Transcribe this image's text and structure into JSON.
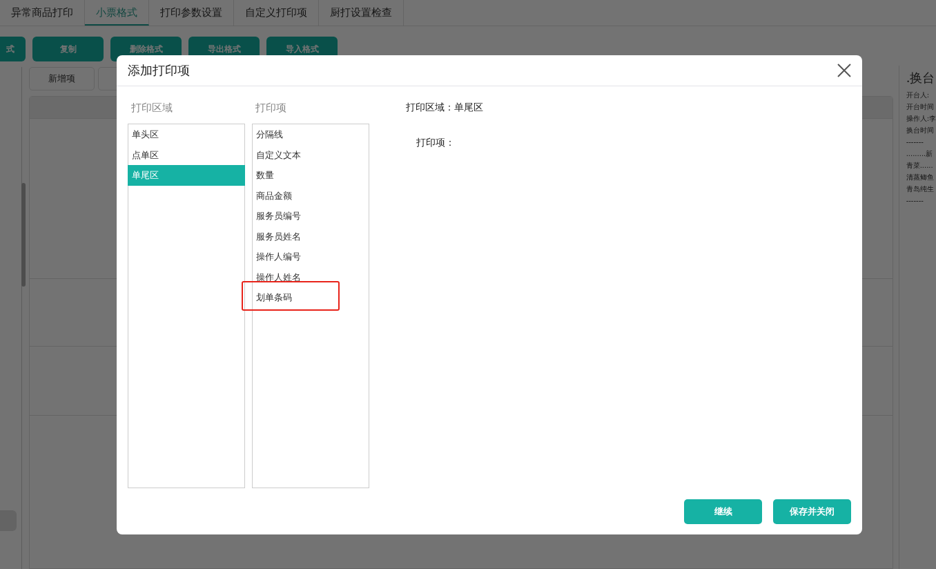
{
  "tabs": [
    {
      "label": "异常商品打印",
      "selected": false
    },
    {
      "label": "小票格式",
      "selected": true
    },
    {
      "label": "打印参数设置",
      "selected": false
    },
    {
      "label": "自定义打印项",
      "selected": false
    },
    {
      "label": "厨打设置检查",
      "selected": false
    }
  ],
  "toolbar_buttons": [
    "式",
    "复制",
    "删除格式",
    "导出格式",
    "导入格式"
  ],
  "sub_buttons": [
    "新增项"
  ],
  "receipt_preview": {
    "title": ".换台",
    "lines": [
      "开台人:",
      "开台时间",
      "操作人:李",
      "换台时间",
      "-------",
      ".........新",
      "青菜......",
      "清蒸鲫鱼",
      "青岛纯生",
      "-------"
    ]
  },
  "dialog": {
    "title": "添加打印项",
    "area_list": {
      "label": "打印区域",
      "items": [
        {
          "label": "单头区",
          "selected": false
        },
        {
          "label": "点单区",
          "selected": false
        },
        {
          "label": "单尾区",
          "selected": true
        }
      ]
    },
    "item_list": {
      "label": "打印项",
      "items": [
        {
          "label": "分隔线",
          "highlighted": false
        },
        {
          "label": "自定义文本",
          "highlighted": false
        },
        {
          "label": "数量",
          "highlighted": false
        },
        {
          "label": "商品金额",
          "highlighted": false
        },
        {
          "label": "服务员编号",
          "highlighted": false
        },
        {
          "label": "服务员姓名",
          "highlighted": false
        },
        {
          "label": "操作人编号",
          "highlighted": false
        },
        {
          "label": "操作人姓名",
          "highlighted": false
        },
        {
          "label": "划单条码",
          "highlighted": true
        }
      ]
    },
    "area_field": {
      "label": "打印区域：",
      "value": "单尾区"
    },
    "items_field": {
      "label": "打印项："
    },
    "buttons": [
      "继续",
      "保存并关闭"
    ]
  }
}
